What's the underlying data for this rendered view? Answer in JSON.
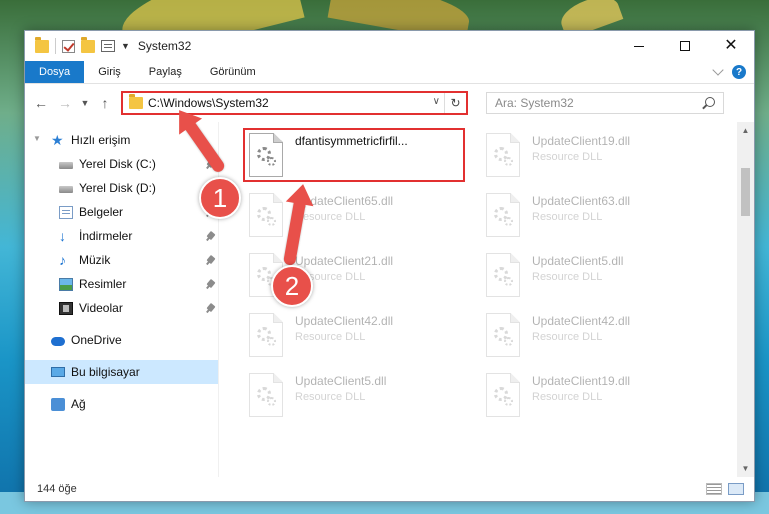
{
  "window": {
    "title": "System32",
    "controls": [
      "minimize-icon",
      "maximize-icon",
      "close-icon"
    ]
  },
  "ribbon": {
    "tabs": [
      "Dosya",
      "Giriş",
      "Paylaş",
      "Görünüm"
    ],
    "help": "?"
  },
  "address": {
    "path": "C:\\Windows\\System32"
  },
  "search": {
    "placeholder": "Ara: System32"
  },
  "sidebar": {
    "quick_access": "Hızlı erişim",
    "items": [
      {
        "label": "Yerel Disk (C:)",
        "icon": "disk-icon",
        "pinned": true
      },
      {
        "label": "Yerel Disk (D:)",
        "icon": "disk-icon",
        "pinned": false
      },
      {
        "label": "Belgeler",
        "icon": "documents-icon",
        "pinned": true
      },
      {
        "label": "İndirmeler",
        "icon": "download-icon",
        "pinned": true
      },
      {
        "label": "Müzik",
        "icon": "music-icon",
        "pinned": true
      },
      {
        "label": "Resimler",
        "icon": "pictures-icon",
        "pinned": true
      },
      {
        "label": "Videolar",
        "icon": "videos-icon",
        "pinned": true
      }
    ],
    "onedrive": "OneDrive",
    "this_pc": "Bu bilgisayar",
    "network": "Ağ"
  },
  "files": [
    {
      "name": "dfantisymmetricfirfil...",
      "type": "",
      "highlighted": true
    },
    {
      "name": "UpdateClient19.dll",
      "type": "Resource DLL"
    },
    {
      "name": "UpdateClient65.dll",
      "type": "Resource DLL"
    },
    {
      "name": "UpdateClient63.dll",
      "type": "Resource DLL"
    },
    {
      "name": "UpdateClient21.dll",
      "type": "Resource DLL"
    },
    {
      "name": "UpdateClient5.dll",
      "type": "Resource DLL"
    },
    {
      "name": "UpdateClient42.dll",
      "type": "Resource DLL"
    },
    {
      "name": "UpdateClient42.dll",
      "type": "Resource DLL"
    },
    {
      "name": "UpdateClient5.dll",
      "type": "Resource DLL"
    },
    {
      "name": "UpdateClient19.dll",
      "type": "Resource DLL"
    }
  ],
  "status": {
    "count": "144 öğe"
  },
  "annotations": {
    "step1": "1",
    "step2": "2",
    "color": "#e8504a"
  }
}
